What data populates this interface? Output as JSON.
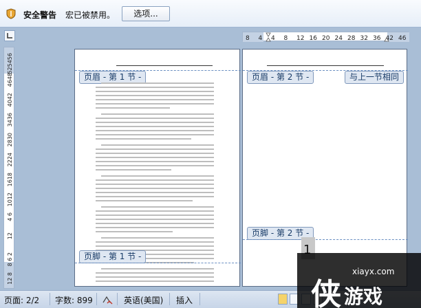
{
  "security_bar": {
    "title": "安全警告",
    "message": "宏已被禁用。",
    "options_button": "选项..."
  },
  "ruler": {
    "horizontal_labels": [
      "8",
      "4",
      "4",
      "8",
      "12",
      "16",
      "20",
      "24",
      "28",
      "32",
      "36",
      "42",
      "46"
    ],
    "vertical_labels": [
      "525456",
      "4648",
      "4042",
      "3436",
      "2830",
      "2224",
      "1618",
      "1012",
      "4 6",
      "12",
      "8 6 2",
      "12 8"
    ]
  },
  "page1": {
    "header_tag": "页眉 - 第 1 节 -",
    "footer_tag": "页脚 - 第 1 节 -"
  },
  "page2": {
    "header_tag": "页眉 - 第 2 节 -",
    "link_tag": "与上一节相同",
    "footer_tag": "页脚 - 第 2 节 -"
  },
  "section_number": "1",
  "status_bar": {
    "page": "页面: 2/2",
    "words": "字数: 899",
    "language": "英语(美国)",
    "mode": "插入"
  },
  "watermark": {
    "url": "xiayx.com",
    "logo_char": "侠",
    "text": "游戏"
  },
  "colors": {
    "canvas": "#a9bed6",
    "tag_bg": "#dfe7f2",
    "dash": "#6a8fc2"
  }
}
